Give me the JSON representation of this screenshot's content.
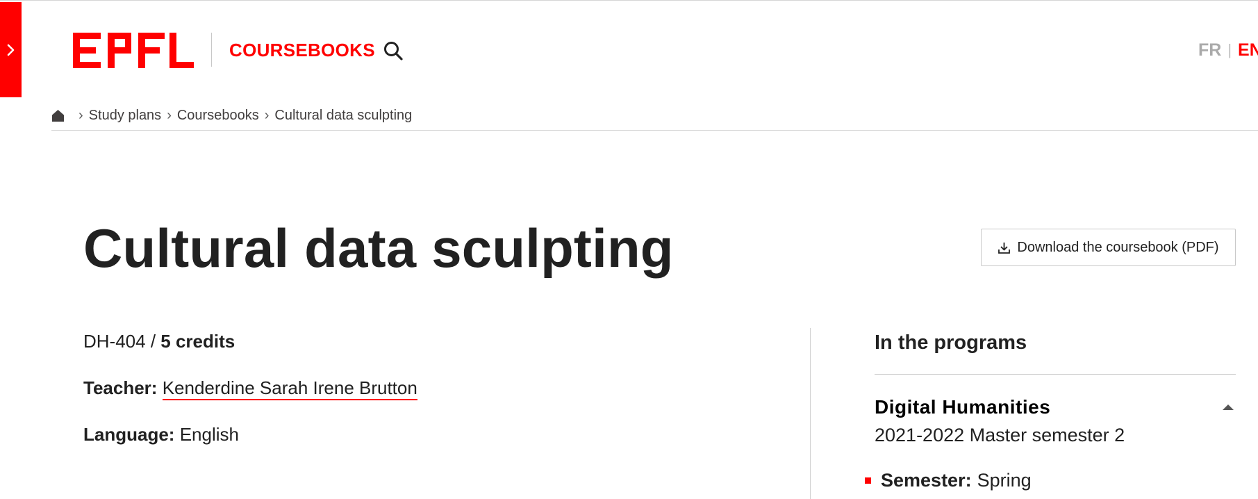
{
  "header": {
    "logo_text": "EPFL",
    "site_title": "COURSEBOOKS",
    "languages": {
      "fr": "FR",
      "separator": "|",
      "en": "EN"
    }
  },
  "breadcrumb": {
    "separator": "›",
    "items": [
      "Study plans",
      "Coursebooks"
    ],
    "current": "Cultural data sculpting"
  },
  "course": {
    "title": "Cultural data sculpting",
    "code": "DH-404",
    "code_sep": " / ",
    "credits": "5 credits",
    "teacher_label": "Teacher:",
    "teacher_name": "Kenderdine Sarah Irene Brutton",
    "language_label": "Language:",
    "language_value": "English",
    "download_label": "Download the coursebook (PDF)"
  },
  "programs": {
    "heading": "In the programs",
    "items": [
      {
        "name": "Digital Humanities",
        "subtitle": "2021-2022 Master semester 2",
        "semester_label": "Semester:",
        "semester_value": "Spring"
      }
    ]
  },
  "colors": {
    "brand_red": "#ff0000",
    "text": "#212121",
    "muted": "#aaaaaa"
  },
  "icons": {
    "drawer": "chevron-right-icon",
    "search": "search-icon",
    "home": "home-icon",
    "download": "download-icon",
    "collapse": "caret-up-icon"
  }
}
